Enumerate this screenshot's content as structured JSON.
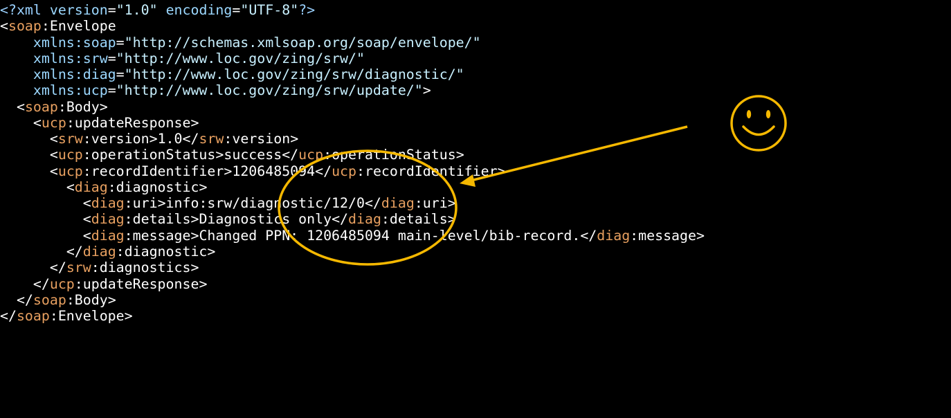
{
  "editor": {
    "background": "#000000",
    "colors": {
      "tag": "#ffffff",
      "prefix": "#e8a060",
      "attr": "#9cd8ff",
      "string": "#c8f0ff",
      "annotation": "#f5b800"
    },
    "lines": [
      {
        "indent": 0,
        "text": "<?xml version=\"1.0\" encoding=\"UTF-8\"?>"
      },
      {
        "indent": 0,
        "text": "<soap:Envelope"
      },
      {
        "indent": 4,
        "text": "xmlns:soap=\"http://schemas.xmlsoap.org/soap/envelope/\""
      },
      {
        "indent": 4,
        "text": "xmlns:srw=\"http://www.loc.gov/zing/srw/\""
      },
      {
        "indent": 4,
        "text": "xmlns:diag=\"http://www.loc.gov/zing/srw/diagnostic/\""
      },
      {
        "indent": 4,
        "text": "xmlns:ucp=\"http://www.loc.gov/zing/srw/update/\">"
      },
      {
        "indent": 2,
        "text": "<soap:Body>"
      },
      {
        "indent": 4,
        "text": "<ucp:updateResponse>"
      },
      {
        "indent": 6,
        "text": "<srw:version>1.0</srw:version>"
      },
      {
        "indent": 6,
        "text": "<ucp:operationStatus>success</ucp:operationStatus>"
      },
      {
        "indent": 6,
        "text": "<ucp:recordIdentifier>1206485094</ucp:recordIdentifier>"
      },
      {
        "indent": 8,
        "text": "<diag:diagnostic>"
      },
      {
        "indent": 10,
        "text": "<diag:uri>info:srw/diagnostic/12/0</diag:uri>"
      },
      {
        "indent": 10,
        "text": "<diag:details>Diagnostics only</diag:details>"
      },
      {
        "indent": 10,
        "text": "<diag:message>Changed PPN: 1206485094 main-level/bib-record.</diag:message>"
      },
      {
        "indent": 8,
        "text": "</diag:diagnostic>"
      },
      {
        "indent": 6,
        "text": "</srw:diagnostics>"
      },
      {
        "indent": 4,
        "text": "</ucp:updateResponse>"
      },
      {
        "indent": 2,
        "text": "</soap:Body>"
      },
      {
        "indent": 0,
        "text": "</soap:Envelope>"
      }
    ]
  },
  "annotations": {
    "highlight_ellipse": "highlighted-record-area",
    "arrow": "pointer-arrow",
    "emoji": "smiley-face-icon"
  }
}
